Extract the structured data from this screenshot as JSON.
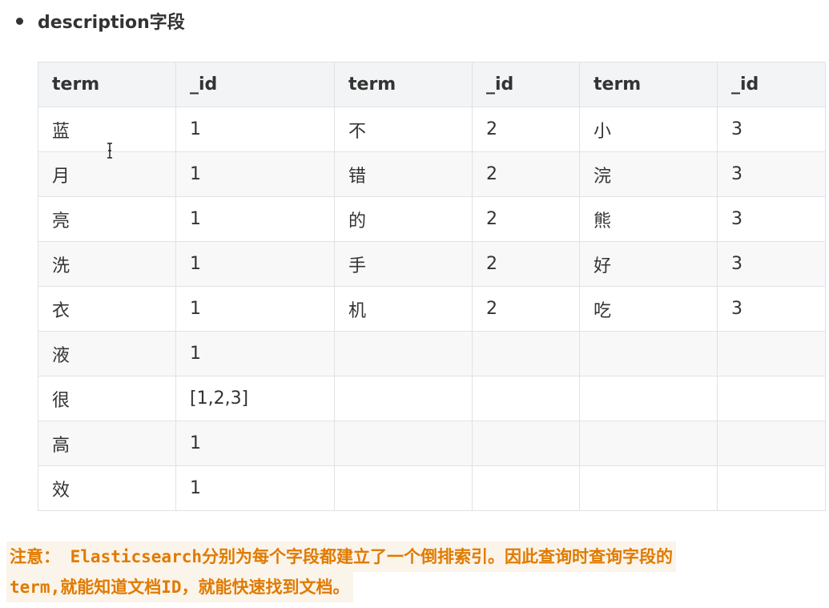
{
  "heading": {
    "text": "description字段"
  },
  "table": {
    "headers": [
      "term",
      "_id",
      "term",
      "_id",
      "term",
      "_id"
    ],
    "rows": [
      [
        "蓝",
        "1",
        "不",
        "2",
        "小",
        "3"
      ],
      [
        "月",
        "1",
        "错",
        "2",
        "浣",
        "3"
      ],
      [
        "亮",
        "1",
        "的",
        "2",
        "熊",
        "3"
      ],
      [
        "洗",
        "1",
        "手",
        "2",
        "好",
        "3"
      ],
      [
        "衣",
        "1",
        "机",
        "2",
        "吃",
        "3"
      ],
      [
        "液",
        "1",
        "",
        "",
        "",
        ""
      ],
      [
        "很",
        "[1,2,3]",
        "",
        "",
        "",
        ""
      ],
      [
        "高",
        "1",
        "",
        "",
        "",
        ""
      ],
      [
        "效",
        "1",
        "",
        "",
        "",
        ""
      ]
    ]
  },
  "note": {
    "line1": "注意： Elasticsearch分别为每个字段都建立了一个倒排索引。因此查询时查询字段的",
    "line2": "term,就能知道文档ID，就能快速找到文档。",
    "color": "#e07a00"
  },
  "cursor": {
    "icon": "text-cursor-icon"
  }
}
